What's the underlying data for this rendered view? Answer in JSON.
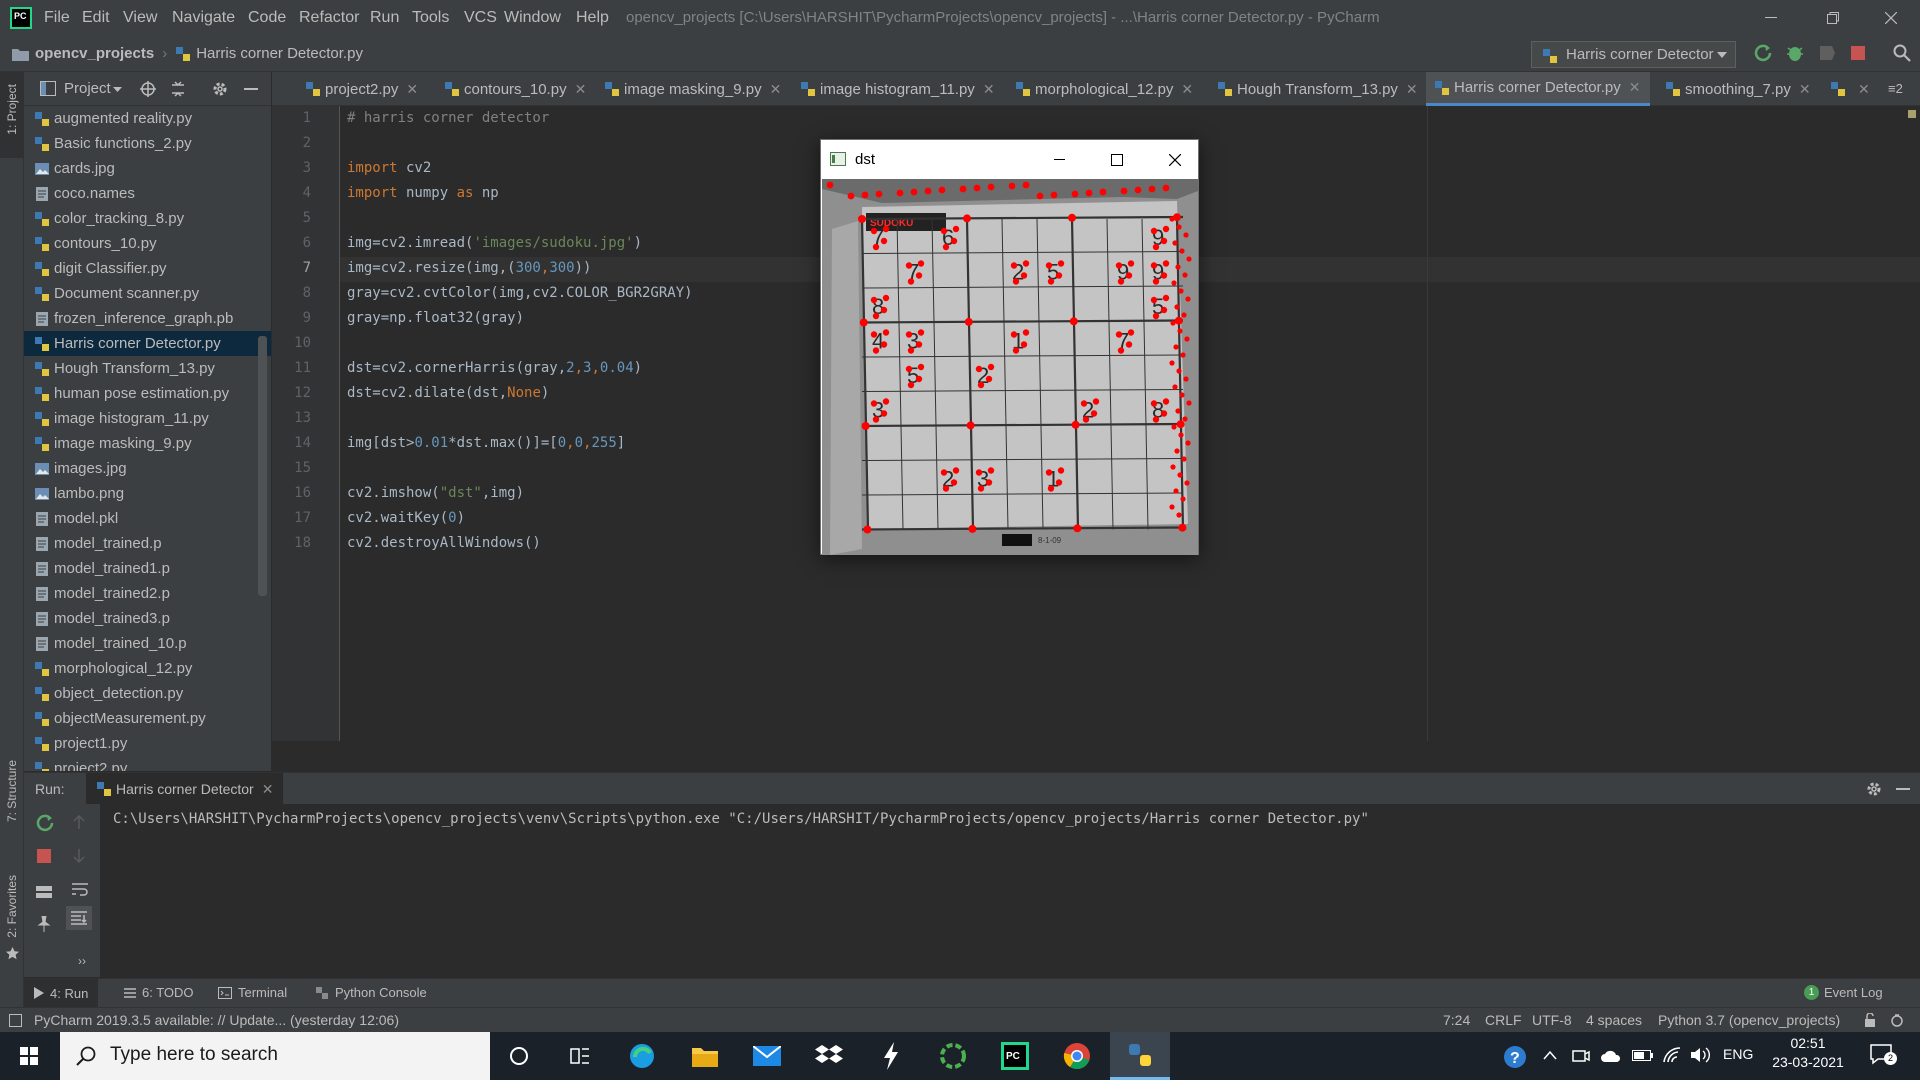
{
  "app": {
    "logo_text": "PC",
    "window_title": "opencv_projects [C:\\Users\\HARSHIT\\PycharmProjects\\opencv_projects] - ...\\Harris corner Detector.py - PyCharm",
    "menu": [
      "File",
      "Edit",
      "View",
      "Navigate",
      "Code",
      "Refactor",
      "Run",
      "Tools",
      "VCS",
      "Window",
      "Help"
    ]
  },
  "breadcrumb": {
    "project": "opencv_projects",
    "file": "Harris corner Detector.py"
  },
  "run_config": {
    "name": "Harris corner Detector"
  },
  "side_labels": {
    "project": "1: Project",
    "structure": "7: Structure",
    "favorites": "2: Favorites"
  },
  "project_panel": {
    "title": "Project",
    "files": [
      "augmented reality.py",
      "Basic functions_2.py",
      "cards.jpg",
      "coco.names",
      "color_tracking_8.py",
      "contours_10.py",
      "digit Classifier.py",
      "Document scanner.py",
      "frozen_inference_graph.pb",
      "Harris corner Detector.py",
      "Hough Transform_13.py",
      "human pose estimation.py",
      "image histogram_11.py",
      "image masking_9.py",
      "images.jpg",
      "lambo.png",
      "model.pkl",
      "model_trained.p",
      "model_trained1.p",
      "model_trained2.p",
      "model_trained3.p",
      "model_trained_10.p",
      "morphological_12.py",
      "object_detection.py",
      "objectMeasurement.py",
      "project1.py",
      "project2.py"
    ],
    "selected": "Harris corner Detector.py"
  },
  "tabs": [
    {
      "label": "project2.py"
    },
    {
      "label": "contours_10.py"
    },
    {
      "label": "image masking_9.py"
    },
    {
      "label": "image histogram_11.py"
    },
    {
      "label": "morphological_12.py"
    },
    {
      "label": "Hough Transform_13.py"
    },
    {
      "label": "Harris corner Detector.py",
      "active": true
    },
    {
      "label": "smoothing_7.py"
    }
  ],
  "tab_overflow": "≡2",
  "editor": {
    "line_numbers": [
      "1",
      "2",
      "3",
      "4",
      "5",
      "6",
      "7",
      "8",
      "9",
      "10",
      "11",
      "12",
      "13",
      "14",
      "15",
      "16",
      "17",
      "18"
    ],
    "code": {
      "c1": "# harris corner detector",
      "c3a": "import",
      "c3b": " cv2",
      "c4a": "import",
      "c4b": " numpy ",
      "c4c": "as",
      "c4d": " np",
      "c6a": "img=cv2.imread(",
      "c6b": "'images/sudoku.jpg'",
      "c6c": ")",
      "c7a": "img=cv2.resize(img,(",
      "c7b": "300",
      "c7c": ",",
      "c7d": "300",
      "c7e": "))",
      "c8": "gray=cv2.cvtColor(img,cv2.COLOR_BGR2GRAY)",
      "c9": "gray=np.float32(gray)",
      "c11a": "dst=cv2.cornerHarris(gray,",
      "c11b": "2",
      "c11c": ",",
      "c11d": "3",
      "c11e": ",",
      "c11f": "0.04",
      "c11g": ")",
      "c12a": "dst=cv2.dilate(dst,",
      "c12b": "None",
      "c12c": ")",
      "c14a": "img[dst>",
      "c14b": "0.01",
      "c14c": "*dst.max()]=[",
      "c14d": "0",
      "c14e": ",",
      "c14f": "0",
      "c14g": ",",
      "c14h": "255",
      "c14i": "]",
      "c16a": "cv2.imshow(",
      "c16b": "\"dst\"",
      "c16c": ",img)",
      "c17a": "cv2.waitKey(",
      "c17b": "0",
      "c17c": ")",
      "c18": "cv2.destroyAllWindows()"
    }
  },
  "dst_window": {
    "title": "dst",
    "sudoku_header": "SUDOKU",
    "sudoku_footer": "8-1-09",
    "digits": [
      {
        "d": "7",
        "r": 0,
        "c": 0
      },
      {
        "d": "6",
        "r": 0,
        "c": 2
      },
      {
        "d": "9",
        "r": 0,
        "c": 8
      },
      {
        "d": "7",
        "r": 1,
        "c": 1
      },
      {
        "d": "2",
        "r": 1,
        "c": 4
      },
      {
        "d": "5",
        "r": 1,
        "c": 5
      },
      {
        "d": "9",
        "r": 1,
        "c": 7
      },
      {
        "d": "9",
        "r": 1,
        "c": 8
      },
      {
        "d": "8",
        "r": 2,
        "c": 0
      },
      {
        "d": "5",
        "r": 2,
        "c": 8
      },
      {
        "d": "4",
        "r": 3,
        "c": 0
      },
      {
        "d": "3",
        "r": 3,
        "c": 1
      },
      {
        "d": "1",
        "r": 3,
        "c": 4
      },
      {
        "d": "7",
        "r": 3,
        "c": 7
      },
      {
        "d": "5",
        "r": 4,
        "c": 1
      },
      {
        "d": "2",
        "r": 4,
        "c": 3
      },
      {
        "d": "3",
        "r": 5,
        "c": 0
      },
      {
        "d": "2",
        "r": 5,
        "c": 6
      },
      {
        "d": "8",
        "r": 5,
        "c": 8
      },
      {
        "d": "2",
        "r": 7,
        "c": 2
      },
      {
        "d": "3",
        "r": 7,
        "c": 3
      },
      {
        "d": "1",
        "r": 7,
        "c": 5
      }
    ]
  },
  "run_panel": {
    "label": "Run:",
    "tab": "Harris corner Detector",
    "output": "C:\\Users\\HARSHIT\\PycharmProjects\\opencv_projects\\venv\\Scripts\\python.exe \"C:/Users/HARSHIT/PycharmProjects/opencv_projects/Harris corner Detector.py\""
  },
  "bottom_tabs": {
    "run": "4: Run",
    "todo": "6: TODO",
    "terminal": "Terminal",
    "python_console": "Python Console",
    "event_log": "Event Log",
    "event_count": "1"
  },
  "status": {
    "message": "PyCharm 2019.3.5 available: // Update... (yesterday 12:06)",
    "position": "7:24",
    "line_sep": "CRLF",
    "encoding": "UTF-8",
    "indent": "4 spaces",
    "interpreter": "Python 3.7 (opencv_projects)"
  },
  "taskbar": {
    "search_placeholder": "Type here to search",
    "lang": "ENG",
    "time": "02:51",
    "date": "23-03-2021",
    "notif_count": "2"
  },
  "colors": {
    "corner_marks": "#ff0000",
    "active_tab_underline": "#4a88c7",
    "selection": "#0d293e"
  }
}
